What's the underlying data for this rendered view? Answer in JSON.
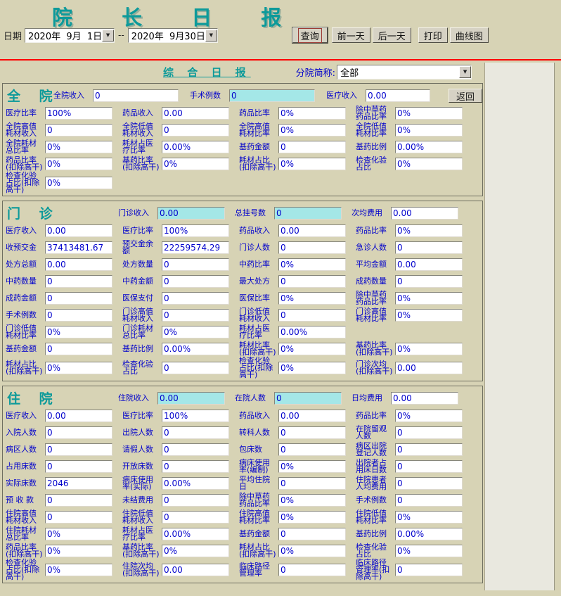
{
  "header": {
    "title": "院 长 日 报",
    "date_label": "日期",
    "date_from": "2020年  9月  1日",
    "date_separator": "--",
    "date_to": "2020年  9月30日",
    "buttons": {
      "query": "查询",
      "prev_day": "前一天",
      "next_day": "后一天",
      "print": "打印",
      "curve": "曲线图"
    }
  },
  "subheader": {
    "report_title": "综 合 日 报",
    "branch_label": "分院简称:",
    "branch_value": "全部"
  },
  "icons": {
    "dropdown_arrow": "▼"
  },
  "colors": {
    "background": "#d7d3b5",
    "accent_teal": "#0d9a9a",
    "label_blue": "#0000cc",
    "highlight_cyan": "#a4e7e7",
    "divider_red": "#ff0000",
    "box_bg": "#ffffff"
  },
  "sections": [
    {
      "id": "hospital",
      "title": "全 院",
      "rows": [
        [
          {
            "t": "title",
            "w": 68
          },
          {
            "label": "全院收入",
            "value": "0",
            "lw": 56,
            "vw": 122
          },
          {
            "label": "手术例数",
            "value": "0",
            "cyan": true,
            "lw": 56,
            "vw": 122
          },
          {
            "label": "医疗收入",
            "value": "0.00",
            "lw": 56,
            "vw": 92
          },
          {
            "t": "button",
            "label": "返回"
          }
        ],
        [
          {
            "label": "医疗比率",
            "value": "100%"
          },
          {
            "label": "药品收入",
            "value": "0.00"
          },
          {
            "label": "药品比率",
            "value": "0%"
          },
          {
            "label": "除中草药药品比率",
            "value": "0%"
          }
        ],
        [
          {
            "label": "全院高值耗材收入",
            "value": "0"
          },
          {
            "label": "全院低值耗材收入",
            "value": "0"
          },
          {
            "label": "全院高值耗材比率",
            "value": "0%"
          },
          {
            "label": "全院低值耗材比率",
            "value": "0%"
          }
        ],
        [
          {
            "label": "全院耗材总比率",
            "value": "0%"
          },
          {
            "label": "耗材占医疗比率",
            "value": "0.00%"
          },
          {
            "label": "基药金额",
            "value": "0"
          },
          {
            "label": "基药比例",
            "value": "0.00%"
          }
        ],
        [
          {
            "label": "药品比率(扣除高干)",
            "value": "0%"
          },
          {
            "label": "基药比率(扣除高干)",
            "value": "0%"
          },
          {
            "label": "耗材占比(扣除高干)",
            "value": "0%"
          },
          {
            "label": "检查化验占比",
            "value": "0%"
          }
        ],
        [
          {
            "label": "检查化验占比(扣除高干)",
            "value": "0%"
          }
        ]
      ]
    },
    {
      "id": "outpatient",
      "title": "门 诊",
      "rows": [
        [
          {
            "t": "title"
          },
          {
            "label": "门诊收入",
            "value": "0.00",
            "cyan": true
          },
          {
            "label": "总挂号数",
            "value": "0",
            "cyan": true
          },
          {
            "label": "次均费用",
            "value": "0.00"
          }
        ],
        [
          {
            "label": "医疗收入",
            "value": "0.00"
          },
          {
            "label": "医疗比率",
            "value": "100%"
          },
          {
            "label": "药品收入",
            "value": "0.00"
          },
          {
            "label": "药品比率",
            "value": "0%"
          }
        ],
        [
          {
            "label": "收预交金",
            "value": "37413481.67"
          },
          {
            "label": "预交金余额",
            "value": "22259574.29"
          },
          {
            "label": "门诊人数",
            "value": "0"
          },
          {
            "label": "急诊人数",
            "value": "0"
          }
        ],
        [
          {
            "label": "处方总额",
            "value": "0.00"
          },
          {
            "label": "处方数量",
            "value": "0"
          },
          {
            "label": "中药比率",
            "value": "0%"
          },
          {
            "label": "平均金额",
            "value": "0.00"
          }
        ],
        [
          {
            "label": "中药数量",
            "value": "0"
          },
          {
            "label": "中药金额",
            "value": "0"
          },
          {
            "label": "最大处方",
            "value": "0"
          },
          {
            "label": "成药数量",
            "value": "0"
          }
        ],
        [
          {
            "label": "成药金额",
            "value": "0"
          },
          {
            "label": "医保支付",
            "value": "0"
          },
          {
            "label": "医保比率",
            "value": "0%"
          },
          {
            "label": "除中草药药品比率",
            "value": "0%"
          }
        ],
        [
          {
            "label": "手术例数",
            "value": "0"
          },
          {
            "label": "门诊高值耗材收入",
            "value": "0"
          },
          {
            "label": "门诊低值耗材收入",
            "value": "0"
          },
          {
            "label": "门诊高值耗材比率",
            "value": "0%"
          }
        ],
        [
          {
            "label": "门诊低值耗材比率",
            "value": "0%"
          },
          {
            "label": "门诊耗材总比率",
            "value": "0%"
          },
          {
            "label": "耗材占医疗比率",
            "value": "0.00%"
          }
        ],
        [
          {
            "label": "基药金额",
            "value": "0"
          },
          {
            "label": "基药比例",
            "value": "0.00%"
          },
          {
            "label": "耗材比率(扣除高干)",
            "value": "0%"
          },
          {
            "label": "基药比率(扣除高干)",
            "value": "0%"
          }
        ],
        [
          {
            "label": "耗材占比(扣除高干)",
            "value": "0%"
          },
          {
            "label": "检查化验占比",
            "value": "0"
          },
          {
            "label": "检查化验占比(扣除高干)",
            "value": "0%"
          },
          {
            "label": "门诊次均(扣除高干)",
            "value": "0.00"
          }
        ]
      ]
    },
    {
      "id": "inpatient",
      "title": "住 院",
      "rows": [
        [
          {
            "t": "title"
          },
          {
            "label": "住院收入",
            "value": "0.00",
            "cyan": true
          },
          {
            "label": "在院人数",
            "value": "0",
            "cyan": true
          },
          {
            "label": "日均费用",
            "value": "0.00"
          }
        ],
        [
          {
            "label": "医疗收入",
            "value": "0.00"
          },
          {
            "label": "医疗比率",
            "value": "100%"
          },
          {
            "label": "药品收入",
            "value": "0.00"
          },
          {
            "label": "药品比率",
            "value": "0%"
          }
        ],
        [
          {
            "label": "入院人数",
            "value": "0"
          },
          {
            "label": "出院人数",
            "value": "0"
          },
          {
            "label": "转科人数",
            "value": "0"
          },
          {
            "label": "在院留观人数",
            "value": "0"
          }
        ],
        [
          {
            "label": "病区人数",
            "value": "0"
          },
          {
            "label": "请假人数",
            "value": "0"
          },
          {
            "label": "包床数",
            "value": "0"
          },
          {
            "label": "病区出院登记人数",
            "value": "0"
          }
        ],
        [
          {
            "label": "占用床数",
            "value": "0"
          },
          {
            "label": "开放床数",
            "value": "0"
          },
          {
            "label": "病床使用率(编制)",
            "value": "0%"
          },
          {
            "label": "出院者占用床日数",
            "value": "0"
          }
        ],
        [
          {
            "label": "实际床数",
            "value": "2046"
          },
          {
            "label": "病床使用率(实际)",
            "value": "0.00%"
          },
          {
            "label": "平均住院日",
            "value": "0"
          },
          {
            "label": "住院患者人均费用",
            "value": "0"
          }
        ],
        [
          {
            "label": "预 收 款",
            "value": "0"
          },
          {
            "label": "未结费用",
            "value": "0"
          },
          {
            "label": "除中草药药品比率",
            "value": "0%"
          },
          {
            "label": "手术例数",
            "value": "0"
          }
        ],
        [
          {
            "label": "住院高值耗材收入",
            "value": "0"
          },
          {
            "label": "住院低值耗材收入",
            "value": "0"
          },
          {
            "label": "住院高值耗材比率",
            "value": "0%"
          },
          {
            "label": "住院低值耗材比率",
            "value": "0%"
          }
        ],
        [
          {
            "label": "住院耗材总比率",
            "value": "0%"
          },
          {
            "label": "耗材占医疗比率",
            "value": "0.00%"
          },
          {
            "label": "基药金额",
            "value": "0"
          },
          {
            "label": "基药比例",
            "value": "0.00%"
          }
        ],
        [
          {
            "label": "药品比率(扣除高干)",
            "value": "0%"
          },
          {
            "label": "基药比率(扣除高干)",
            "value": "0%"
          },
          {
            "label": "耗材占比(扣除高干)",
            "value": "0%"
          },
          {
            "label": "检查化验占比",
            "value": "0%"
          }
        ],
        [
          {
            "label": "检查化验占比(扣除高干)",
            "value": "0%"
          },
          {
            "label": "住院次均(扣除高干)",
            "value": "0.00"
          },
          {
            "label": "临床路径管理率",
            "value": "0"
          },
          {
            "label": "临床路径管理率(扣除高干)",
            "value": "0"
          }
        ]
      ]
    }
  ]
}
